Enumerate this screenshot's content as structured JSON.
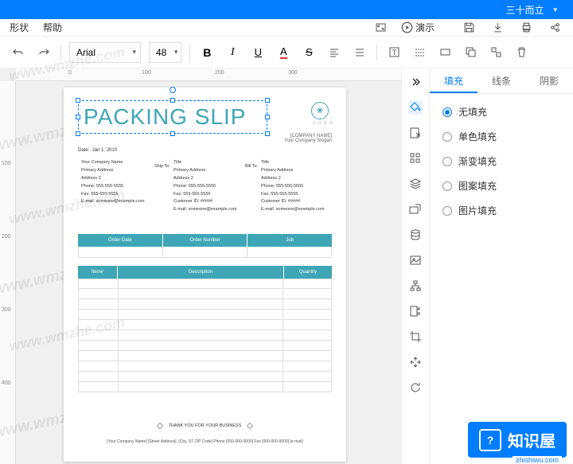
{
  "topbar": {
    "user": "三十而立"
  },
  "menubar": {
    "shape": "形状",
    "help": "帮助",
    "present": "演示"
  },
  "toolbar": {
    "font": "Arial",
    "size": "48"
  },
  "panel": {
    "tabs": {
      "fill": "填充",
      "line": "线条",
      "shadow": "阴影"
    },
    "fill_options": {
      "none": "无填充",
      "solid": "单色填充",
      "gradient": "渐变填充",
      "pattern": "图案填充",
      "image": "图片填充"
    }
  },
  "doc": {
    "title": "PACKING SLIP",
    "company_name": "[COMPANY NAME]",
    "slogan": "Your Company Slogan",
    "date_label": "Date:",
    "date_value": "Jan 1, 2010",
    "ship_to": "Ship To:",
    "bill_to": "Bill To:",
    "addr": {
      "name": "Your Company Name",
      "title": "Title",
      "primary": "Primary Address",
      "addr2": "Address 2",
      "phone": "Phone: 555-555-5555",
      "fax": "Fax: 555-555-5555",
      "cust": "Customer ID: #####",
      "email": "E-mail: someone@example.com"
    },
    "hdr1": {
      "c1": "Order Date",
      "c2": "Order Number",
      "c3": "Job"
    },
    "hdr2": {
      "c1": "Item#",
      "c2": "Description",
      "c3": "Quantity"
    },
    "thank": "THANK YOU FOR YOUR BUSINESS",
    "footer": "[Your Company Name]    [Street Address],    [City, ST ZIP Code]       Phone [000-000-0000]     Fax [000-000-0000]   [e-mail]"
  },
  "watermarks": {
    "wmzhe": "www.wmzhe.com",
    "zhishiwu": "zhishiwu.com"
  },
  "brand": {
    "name": "知识屋"
  }
}
